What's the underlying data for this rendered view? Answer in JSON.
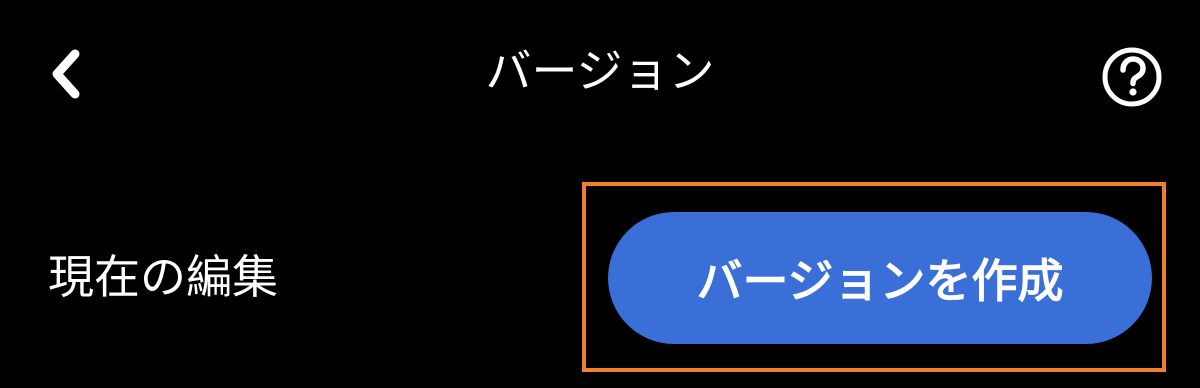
{
  "header": {
    "title": "バージョン",
    "back_icon": "chevron-left-icon",
    "help_icon": "question-circle-icon"
  },
  "current_edit": {
    "label": "現在の編集",
    "create_button_label": "バージョンを作成"
  },
  "colors": {
    "background": "#000000",
    "text": "#ffffff",
    "button": "#3a6fd8",
    "highlight": "#f08030"
  }
}
